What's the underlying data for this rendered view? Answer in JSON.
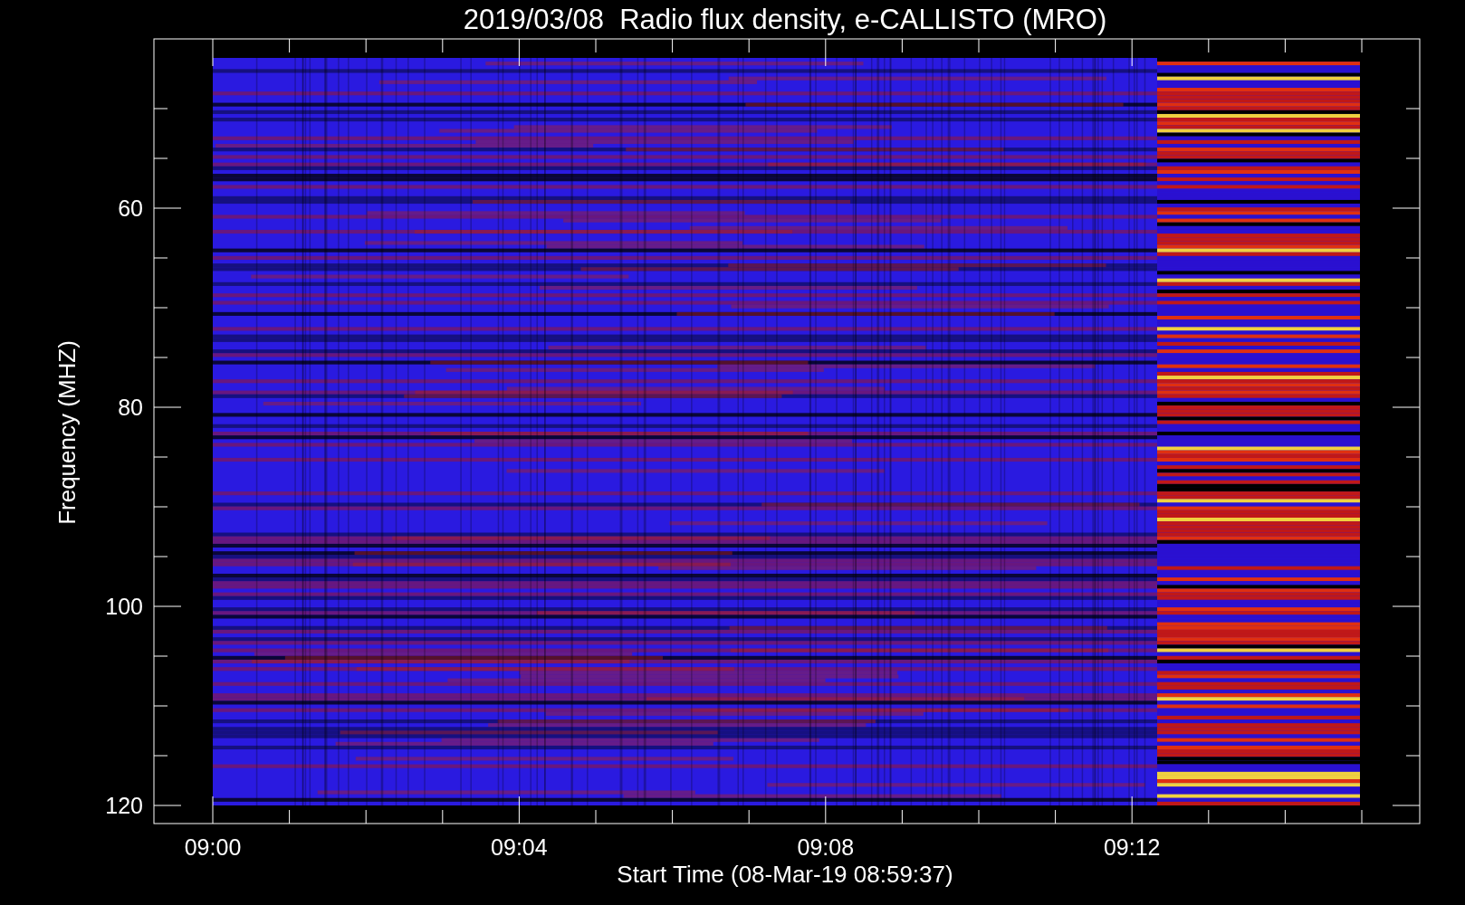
{
  "title": "2019/03/08  Radio flux density, e-CALLISTO (MRO)",
  "y_axis": {
    "label": "Frequency (MHZ)",
    "ticks": [
      "60",
      "80",
      "100",
      "120"
    ]
  },
  "x_axis": {
    "label": "Start Time (08-Mar-19 08:59:37)",
    "ticks": [
      "09:00",
      "09:04",
      "09:08",
      "09:12"
    ]
  }
}
